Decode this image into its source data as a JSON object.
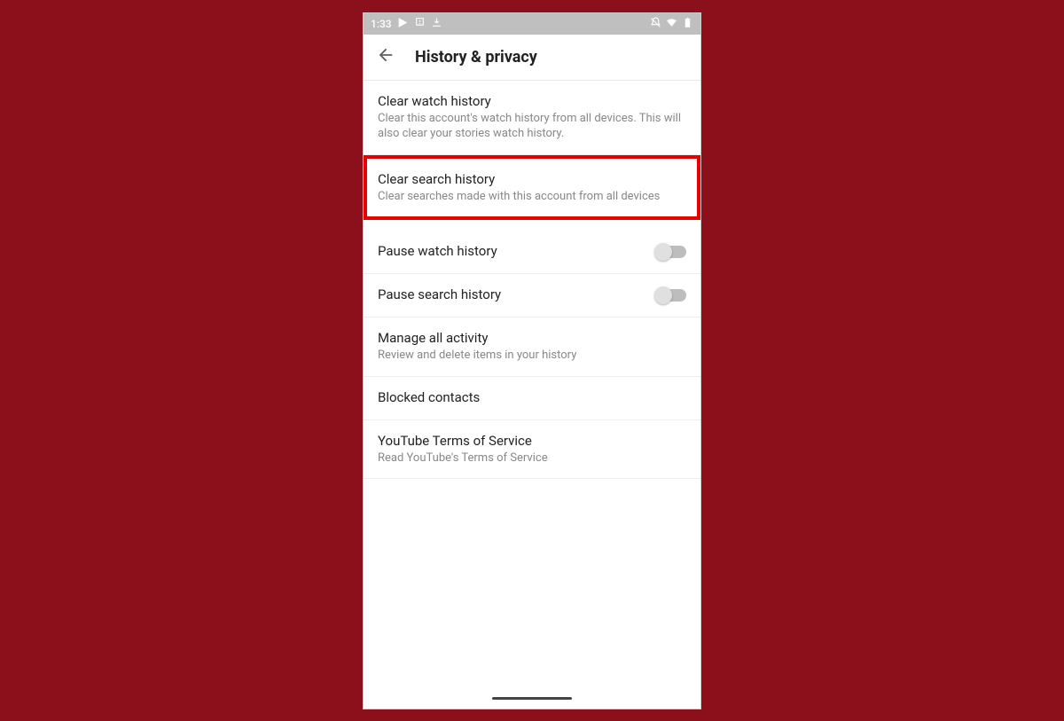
{
  "statusbar": {
    "time": "1:33"
  },
  "appbar": {
    "title": "History & privacy"
  },
  "items": {
    "clear_watch": {
      "title": "Clear watch history",
      "sub": "Clear this account's watch history from all devices. This will also clear your stories watch history."
    },
    "clear_search": {
      "title": "Clear search history",
      "sub": "Clear searches made with this account from all devices"
    },
    "pause_watch": {
      "title": "Pause watch history"
    },
    "pause_search": {
      "title": "Pause search history"
    },
    "manage": {
      "title": "Manage all activity",
      "sub": "Review and delete items in your history"
    },
    "blocked": {
      "title": "Blocked contacts"
    },
    "terms": {
      "title": "YouTube Terms of Service",
      "sub": "Read YouTube's Terms of Service"
    }
  }
}
